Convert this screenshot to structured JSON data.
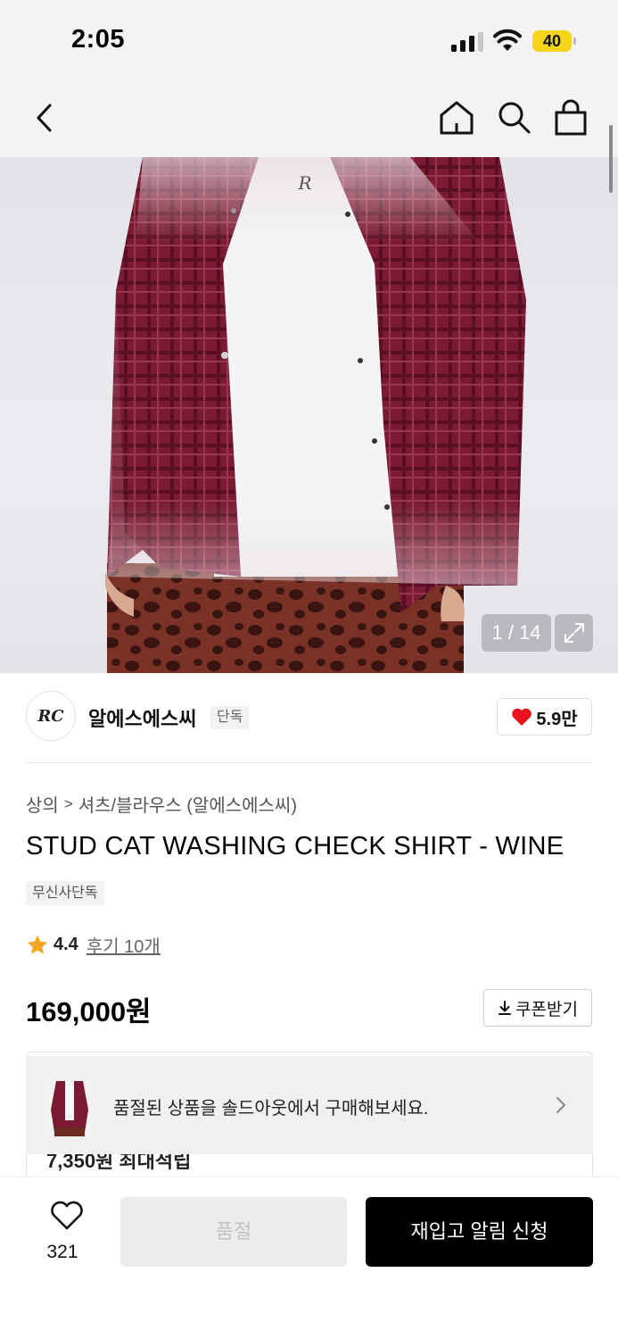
{
  "status_bar": {
    "time": "2:05",
    "battery": "40"
  },
  "nav": {
    "back_icon": "chevron-left-icon",
    "home_icon": "home-icon",
    "search_icon": "search-icon",
    "cart_icon": "shopping-bag-icon"
  },
  "gallery": {
    "counter": "1 / 14"
  },
  "brand": {
    "logo_text": "RC",
    "name": "알에스에스씨",
    "badge": "단독",
    "likes": "5.9만"
  },
  "breadcrumb": {
    "category": "상의",
    "separator": ">",
    "subcategory": "셔츠/블라우스 (알에스에스씨)"
  },
  "product": {
    "title": "STUD CAT WASHING CHECK SHIRT - WINE",
    "tag": "무신사단독",
    "rating": "4.4",
    "review_link": "후기 10개",
    "price": "169,000원",
    "coupon_label": "쿠폰받기"
  },
  "points": {
    "text": "7,350원 최대적립"
  },
  "soldout_banner": {
    "text": "품절된 상품을 솔드아웃에서 구매해보세요."
  },
  "bottom_bar": {
    "wish_count": "321",
    "soldout_label": "품절",
    "restock_label": "재입고 알림 신청"
  },
  "colors": {
    "accent": "#000000",
    "heart": "#e8111c",
    "star": "#f5a623",
    "battery": "#f5d318"
  }
}
